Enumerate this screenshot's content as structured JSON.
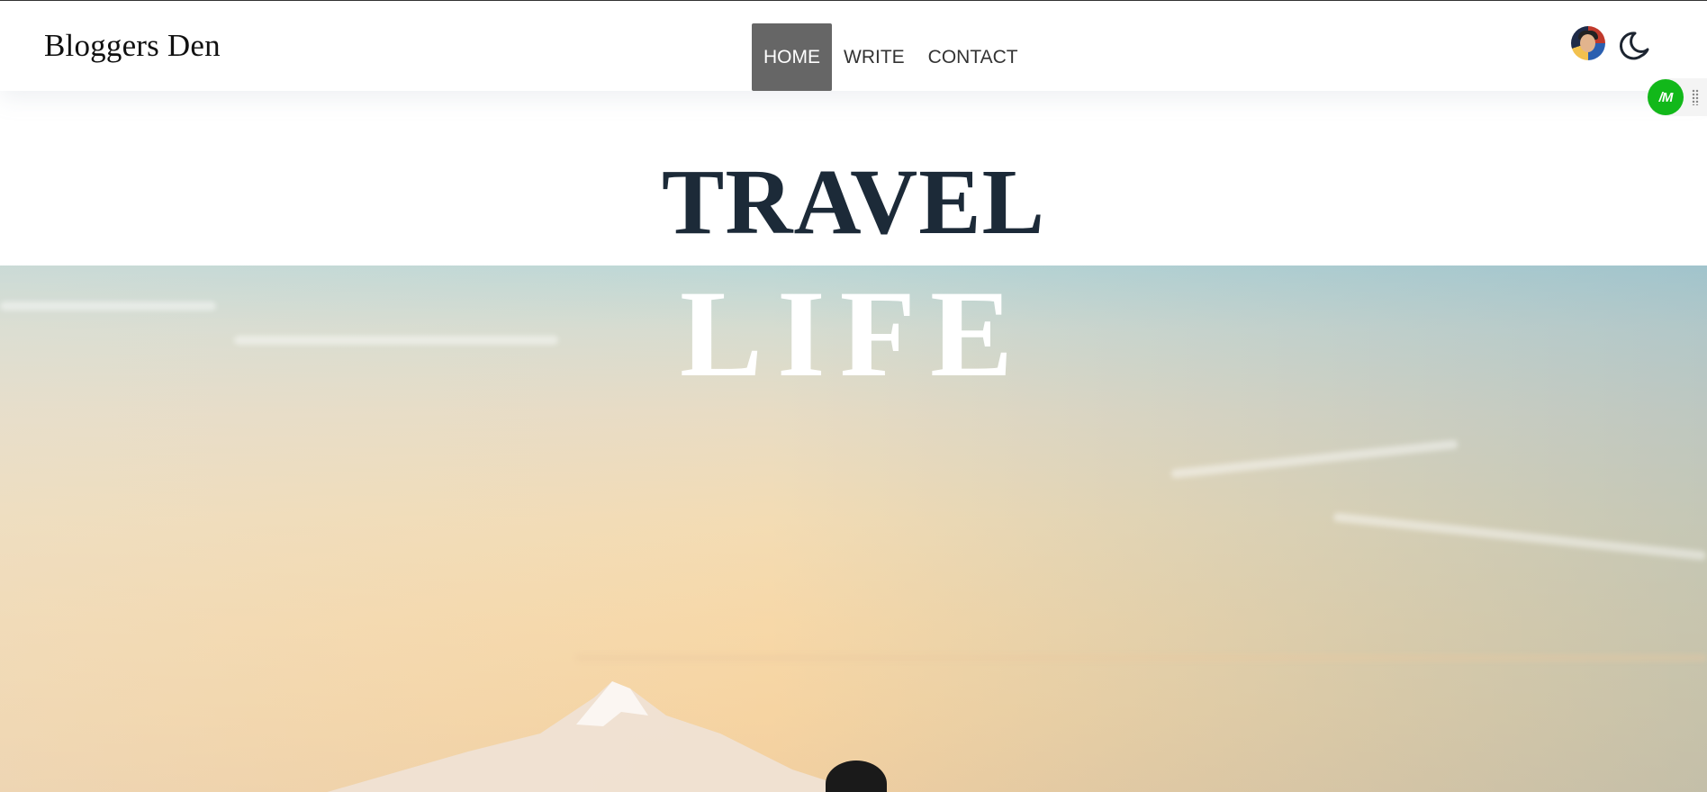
{
  "navbar": {
    "brand": "Bloggers Den",
    "links": [
      {
        "label": "HOME",
        "active": true
      },
      {
        "label": "WRITE",
        "active": false
      },
      {
        "label": "CONTACT",
        "active": false
      }
    ],
    "avatar_icon": "user-avatar",
    "theme_toggle_icon": "moon-icon"
  },
  "extension_badge": {
    "label": "/M",
    "color": "#12b81a",
    "grip_icon": "drag-handle-icon"
  },
  "hero": {
    "title_line1": "TRAVEL",
    "title_line2": "LIFE",
    "title_line1_color": "#1c2a38",
    "title_line2_color": "#ffffff",
    "image_icon": "sunset-mountain-photo"
  },
  "colors": {
    "active_nav_bg": "#666666",
    "nav_text": "#333333"
  }
}
